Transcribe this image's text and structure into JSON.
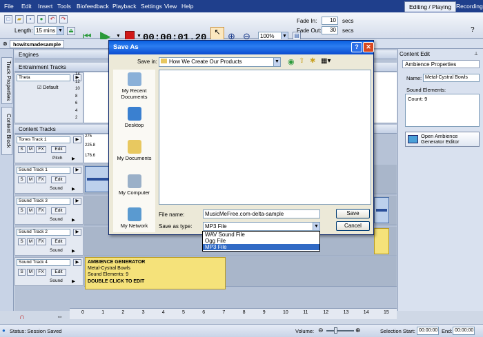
{
  "menu": [
    "File",
    "Edit",
    "Insert",
    "Tools",
    "Biofeedback",
    "Playback",
    "Settings",
    "View",
    "Help"
  ],
  "top_tabs": {
    "editing": "Editing / Playing",
    "recording": "Recording"
  },
  "toolbar": {
    "length_label": "Length:",
    "length_value": "15 mins",
    "time": "00:00:01.20",
    "zoom": "100%",
    "fade_in_label": "Fade In:",
    "fade_in_value": "10",
    "fade_out_label": "Fade Out:",
    "fade_out_value": "30",
    "secs": "secs"
  },
  "doc_tab": "howitsmadesample",
  "side_tabs": [
    "Track Properties",
    "Content Block"
  ],
  "sections": {
    "engines": "Engines",
    "entrainment": "Entrainment Tracks",
    "content": "Content Tracks"
  },
  "entrainment": {
    "track_name": "Theta",
    "default_label": "Default",
    "scale": [
      "14",
      "12",
      "10",
      "8",
      "6",
      "4",
      "2"
    ]
  },
  "tracks": [
    {
      "name": "Tones Track 1",
      "kind": "Pitch",
      "scale": [
        "275",
        "225.8",
        "176.6"
      ]
    },
    {
      "name": "Sound Track 1",
      "kind": "Sound"
    },
    {
      "name": "Sound Track 3",
      "kind": "Sound"
    },
    {
      "name": "Sound Track 2",
      "kind": "Sound"
    },
    {
      "name": "Sound Track 4",
      "kind": "Sound"
    }
  ],
  "track_buttons": {
    "s": "S",
    "m": "M",
    "fx": "FX",
    "edit": "Edit"
  },
  "ambience_block": {
    "title": "AMBIENCE GENERATOR",
    "line1": "Metal-Cystral Bowls",
    "line2": "Sound Elements: 9",
    "line3": "DOUBLE CLICK TO EDIT"
  },
  "ruler": [
    "0",
    "1",
    "2",
    "3",
    "4",
    "5",
    "6",
    "7",
    "8",
    "9",
    "10",
    "11",
    "12",
    "13",
    "14",
    "15"
  ],
  "right_panel": {
    "header": "Content Edit",
    "tab": "Ambience Properties",
    "name_label": "Name:",
    "name_value": "Metal-Cystral Bowls",
    "elements_label": "Sound Elements:",
    "count": "Count: 9",
    "open_button": "Open Ambience Generator Editor"
  },
  "dialog": {
    "title": "Save As",
    "save_in_label": "Save in:",
    "save_in_value": "How We Create Our Products",
    "places": [
      "My Recent Documents",
      "Desktop",
      "My Documents",
      "My Computer",
      "My Network"
    ],
    "file_name_label": "File name:",
    "file_name_value": "MusicMeFree.com-delta-sample",
    "save_as_type_label": "Save as type:",
    "save_as_type_value": "MP3 File",
    "save_button": "Save",
    "cancel_button": "Cancel",
    "type_options": [
      "WAV Sound File",
      "Ogg File",
      "MP3 File"
    ],
    "selected_option": "MP3 File"
  },
  "status": {
    "status_text": "Status: Session Saved",
    "volume_label": "Volume:",
    "selection_start_label": "Selection Start:",
    "selection_start_value": "00:00:00",
    "end_label": "End:",
    "end_value": "00:00:00"
  },
  "colors": {
    "menubar": "#1f3f8c",
    "dialog_title": "#0a5ee0",
    "ambience": "#f5e27a",
    "selection": "#316ac5"
  }
}
